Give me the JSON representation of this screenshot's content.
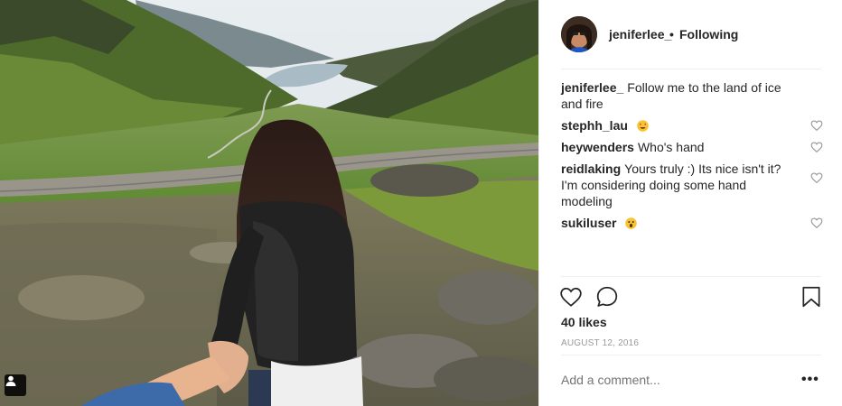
{
  "post": {
    "username": "jeniferlee_",
    "dot": "•",
    "follow_label": "Following",
    "caption_user": "jeniferlee_",
    "caption_text": "Follow me to the land of ice and fire",
    "likes": "40 likes",
    "date": "AUGUST 12, 2016",
    "add_comment_placeholder": "Add a comment...",
    "more_label": "•••"
  },
  "comments": [
    {
      "user": "stephh_lau",
      "text": "",
      "emoji": "smiling-face-heart-eyes"
    },
    {
      "user": "heywenders",
      "text": "Who's hand",
      "emoji": ""
    },
    {
      "user": "reidlaking",
      "text": "Yours truly :) Its nice isn't it? I'm considering doing some hand modeling",
      "emoji": ""
    },
    {
      "user": "sukiluser",
      "text": "",
      "emoji": "screaming-face"
    }
  ],
  "colors": {
    "text": "#262626",
    "muted": "#999999",
    "divider": "#efefef"
  },
  "icons": [
    "heart-icon",
    "comment-icon",
    "bookmark-icon",
    "tag-user-icon",
    "more-options-icon"
  ]
}
